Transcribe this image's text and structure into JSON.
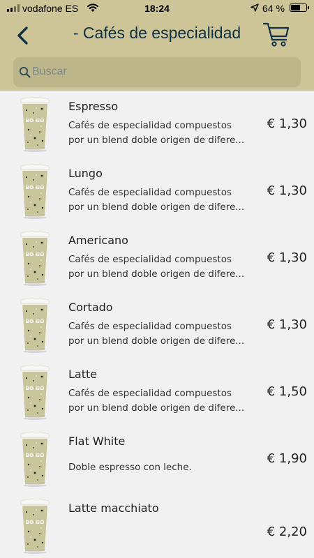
{
  "status_bar": {
    "carrier": "vodafone ES",
    "time": "18:24",
    "battery_percent": "64 %",
    "battery_level": 0.64,
    "icons": [
      "signal-bars",
      "wifi",
      "location-arrow",
      "battery"
    ]
  },
  "header": {
    "title": "- Cafés de especialidad",
    "back_icon": "chevron-left",
    "cart_icon": "shopping-cart",
    "background": "#cdc597",
    "title_color": "#0f3145"
  },
  "search": {
    "placeholder": "Buscar",
    "value": "",
    "icon": "magnifier"
  },
  "products": [
    {
      "name": "Espresso",
      "desc_line1": "Cafés de especialidad compuestos",
      "desc_line2": "por un blend doble origen de difere...",
      "price": "€ 1,30"
    },
    {
      "name": "Lungo",
      "desc_line1": "Cafés de especialidad compuestos",
      "desc_line2": "por un blend doble origen de difere...",
      "price": "€ 1,30"
    },
    {
      "name": "Americano",
      "desc_line1": "Cafés de especialidad compuestos",
      "desc_line2": "por un blend doble origen de difere...",
      "price": "€ 1,30"
    },
    {
      "name": "Cortado",
      "desc_line1": "Cafés de especialidad compuestos",
      "desc_line2": "por un blend doble origen de difere...",
      "price": "€ 1,30"
    },
    {
      "name": "Latte",
      "desc_line1": "Cafés de especialidad compuestos",
      "desc_line2": "por un blend doble origen de difere...",
      "price": "€ 1,50"
    },
    {
      "name": "Flat White",
      "desc_line1": "Doble espresso con leche.",
      "desc_line2": "",
      "price": "€ 1,90"
    },
    {
      "name": "Latte macchiato",
      "desc_line1": "",
      "desc_line2": "",
      "price": "€ 2,20"
    }
  ],
  "cup_label": "BO GO",
  "colors": {
    "accent": "#0f3145",
    "cup": "#c9c69b",
    "list_background": "#f1f1f1"
  }
}
